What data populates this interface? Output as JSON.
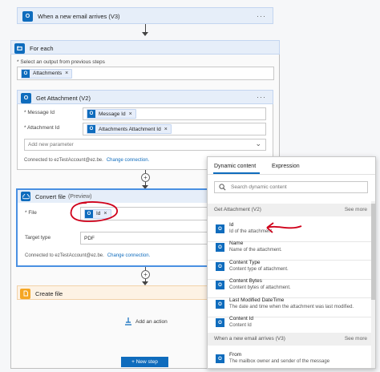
{
  "colors": {
    "brand": "#0f6cbd",
    "loop": "#0f6cbd",
    "convert": "#0f6cbd",
    "create": "#f5a623",
    "annotation": "#d0021b"
  },
  "trigger": {
    "title": "When a new email arrives (V3)",
    "more": "···"
  },
  "foreach": {
    "title": "For each",
    "more": "···",
    "select_label": "* Select an output from previous steps",
    "token": "Attachments",
    "token_x": "×"
  },
  "get_attachment": {
    "title": "Get Attachment (V2)",
    "more": "···",
    "message_id_label": "* Message Id",
    "message_id_token": "Message Id",
    "attachment_id_label": "* Attachment Id",
    "attachment_id_token": "Attachments Attachment Id",
    "token_x": "×",
    "add_param_placeholder": "Add new parameter",
    "chevron": "⌄",
    "connected": "Connected to ezTestAccount@ez.be.",
    "change": "Change connection."
  },
  "convert": {
    "title": "Convert file",
    "title_suffix": "(Preview)",
    "file_label": "* File",
    "file_token": "Id",
    "token_x": "×",
    "target_label": "Target type",
    "target_value": "PDF",
    "connected": "Connected to ezTestAccount@ez.be.",
    "change": "Change connection."
  },
  "create": {
    "title": "Create file"
  },
  "add_action": "Add an action",
  "new_step": "+ New step",
  "dynamic": {
    "tab_dynamic": "Dynamic content",
    "tab_expression": "Expression",
    "search_placeholder": "Search dynamic content",
    "section1": "Get Attachment (V2)",
    "section1_more": "See more",
    "items": [
      {
        "name": "Id",
        "desc": "Id of the attachment."
      },
      {
        "name": "Name",
        "desc": "Name of the attachment."
      },
      {
        "name": "Content Type",
        "desc": "Content type of attachment."
      },
      {
        "name": "Content Bytes",
        "desc": "Content bytes of attachment."
      },
      {
        "name": "Last Modified DateTime",
        "desc": "The date and time when the attachment was last modified."
      },
      {
        "name": "Content Id",
        "desc": "Content Id"
      }
    ],
    "section2": "When a new email arrives (V3)",
    "section2_more": "See more",
    "items2": [
      {
        "name": "From",
        "desc": "The mailbox owner and sender of the message"
      }
    ]
  }
}
